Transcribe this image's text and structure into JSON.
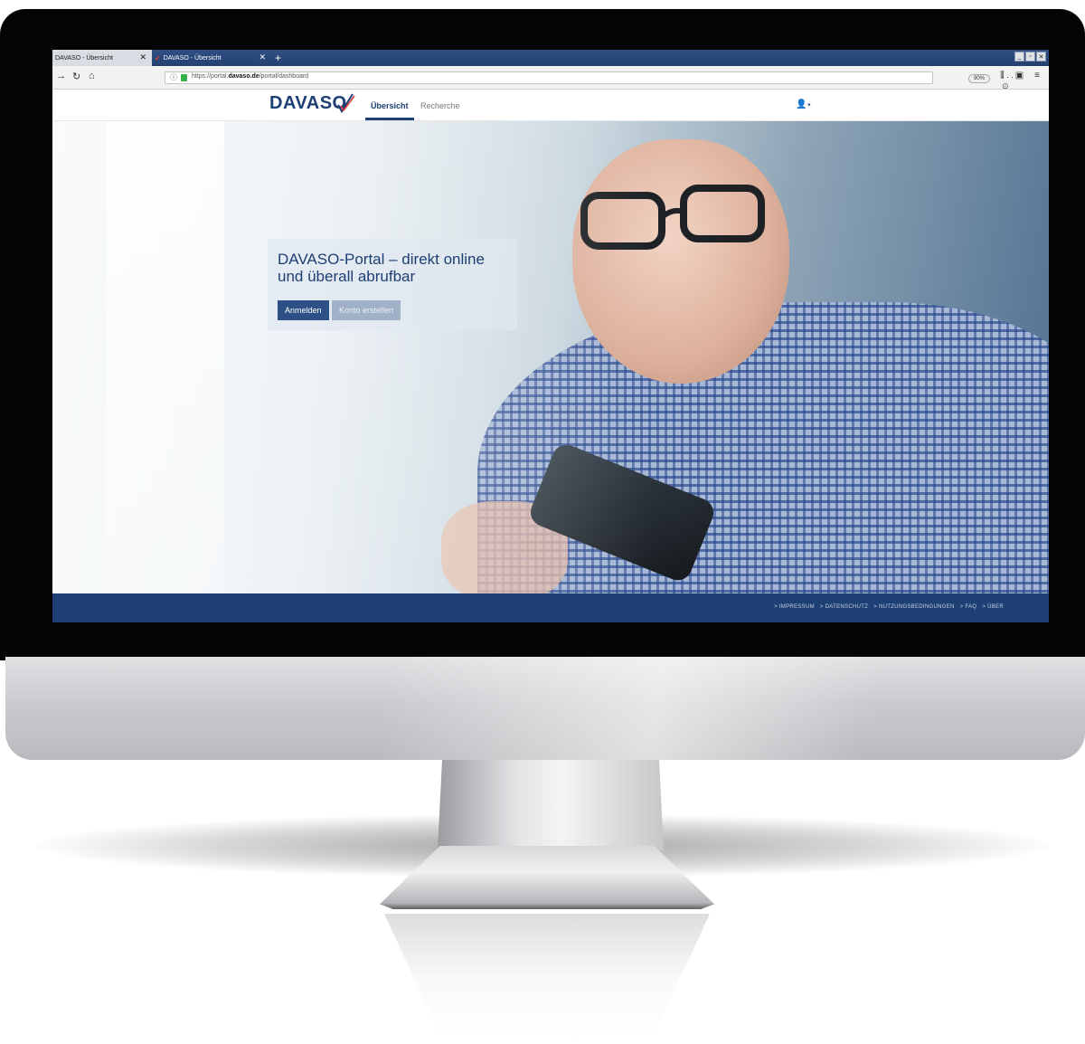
{
  "browser": {
    "tabs": [
      {
        "title": "DAVASO - Übersicht",
        "state": "inactive"
      },
      {
        "title": "DAVASO - Übersicht",
        "state": "active"
      }
    ],
    "url": {
      "prefix": "https://portal.",
      "domain": "davaso.de",
      "path": "/portal/dashboard"
    },
    "zoom": "90%",
    "url_actions": "··· ⊙ ☆"
  },
  "site": {
    "logo_text": "DAVASO",
    "nav": [
      {
        "label": "Übersicht",
        "active": true
      },
      {
        "label": "Recherche",
        "active": false
      }
    ],
    "user_menu": "⯆"
  },
  "hero": {
    "title": "DAVASO-Portal – direkt online und überall abrufbar",
    "login_button": "Anmelden",
    "register_button": "Konto erstellen"
  },
  "footer": {
    "links": [
      "> IMPRESSUM",
      "> DATENSCHUTZ",
      "> NUTZUNGSBEDINGUNGEN",
      "> FAQ",
      "> ÜBER"
    ]
  },
  "colors": {
    "brand_blue": "#1d3f73",
    "logo_check_red": "#d83a3a"
  }
}
